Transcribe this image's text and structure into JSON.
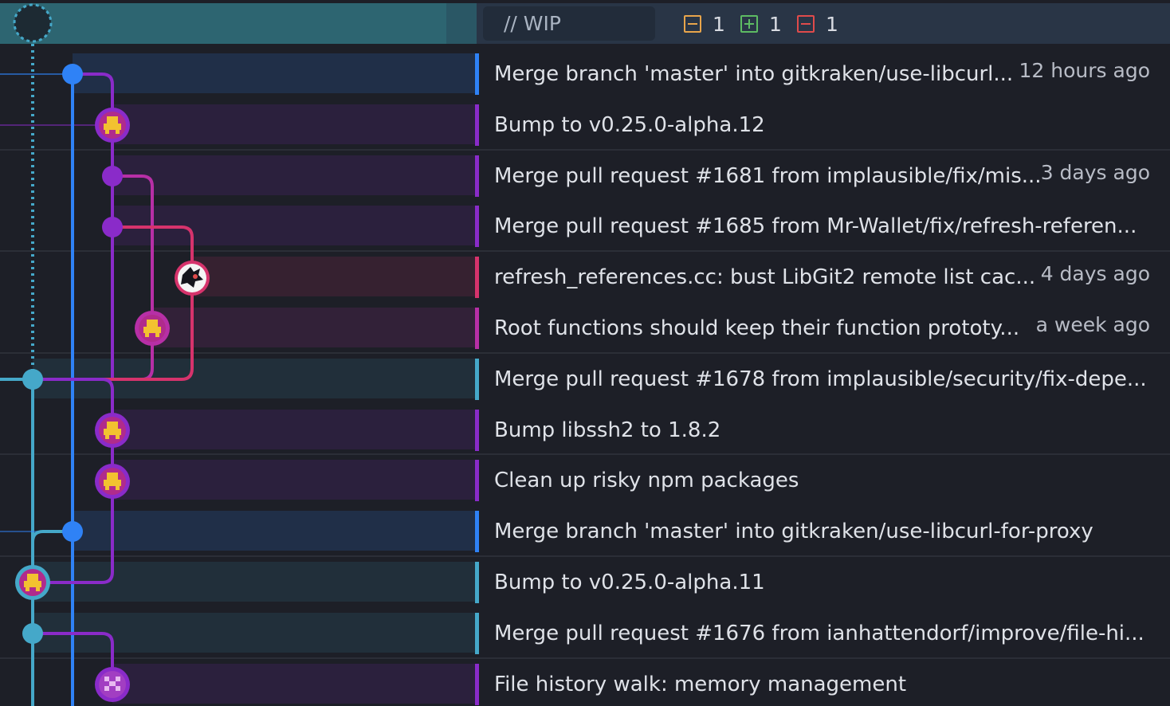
{
  "header": {
    "wip_label": "// WIP",
    "modified_count": "1",
    "added_count": "1",
    "removed_count": "1",
    "modified_color": "#e8a54b",
    "added_color": "#5dbb63",
    "removed_color": "#e04b4b"
  },
  "commits": [
    {
      "message": "Merge branch 'master' into gitkraken/use-libcurl...",
      "time": "12 hours ago",
      "lane_color": "#2f82f6",
      "avatar": "merge-dot"
    },
    {
      "message": "Bump to v0.25.0-alpha.12",
      "time": "",
      "lane_color": "#8a2bc9",
      "avatar": "yellow-robot-avatar"
    },
    {
      "message": "Merge pull request #1681 from implausible/fix/mis...",
      "time": "3 days ago",
      "lane_color": "#8a2bc9",
      "avatar": "merge-dot"
    },
    {
      "message": "Merge pull request #1685 from Mr-Wallet/fix/refresh-referen...",
      "time": "",
      "lane_color": "#8a2bc9",
      "avatar": "merge-dot"
    },
    {
      "message": "refresh_references.cc: bust LibGit2 remote list cac...",
      "time": "4 days ago",
      "lane_color": "#d6336c",
      "avatar": "hedgehog-avatar"
    },
    {
      "message": "Root functions should keep their function prototy...",
      "time": "a week ago",
      "lane_color": "#b72fa6",
      "avatar": "yellow-robot-avatar"
    },
    {
      "message": "Merge pull request #1678 from implausible/security/fix-depe...",
      "time": "",
      "lane_color": "#45a8c9",
      "avatar": "merge-dot"
    },
    {
      "message": "Bump libssh2 to 1.8.2",
      "time": "",
      "lane_color": "#8a2bc9",
      "avatar": "yellow-robot-avatar"
    },
    {
      "message": "Clean up risky npm packages",
      "time": "",
      "lane_color": "#8a2bc9",
      "avatar": "yellow-robot-avatar"
    },
    {
      "message": "Merge branch 'master' into gitkraken/use-libcurl-for-proxy",
      "time": "",
      "lane_color": "#2f82f6",
      "avatar": "merge-dot"
    },
    {
      "message": "Bump to v0.25.0-alpha.11",
      "time": "",
      "lane_color": "#45a8c9",
      "avatar": "yellow-robot-avatar"
    },
    {
      "message": "Merge pull request #1676 from ianhattendorf/improve/file-hi...",
      "time": "",
      "lane_color": "#45a8c9",
      "avatar": "merge-dot"
    },
    {
      "message": "File history walk: memory management",
      "time": "",
      "lane_color": "#8a2bc9",
      "avatar": "purple-pixel-avatar"
    }
  ]
}
